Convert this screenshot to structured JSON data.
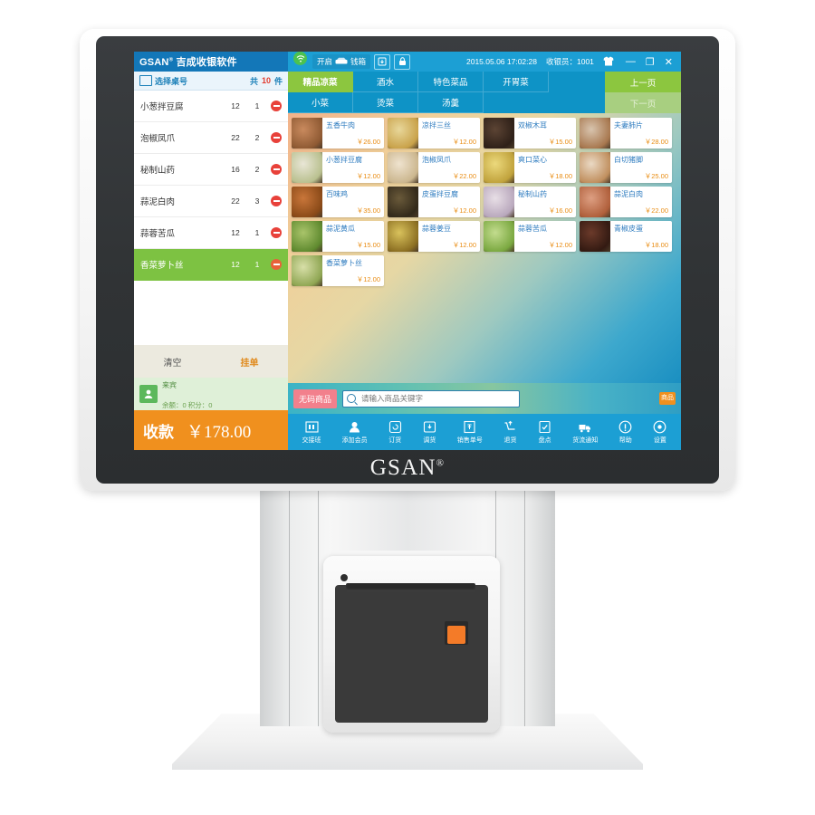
{
  "device": {
    "brand": "GSAN",
    "brand_sup": "®"
  },
  "app": {
    "logo_text": "GSAN",
    "logo_sup": "®",
    "logo_name": "吉成收银软件",
    "drawer_label": "开启",
    "drawer_label2": "钱箱",
    "datetime": "2015.05.06 17:02:28",
    "cashier": "收银员：1001",
    "min_glyph": "—",
    "restore_glyph": "❐",
    "close_glyph": "✕"
  },
  "order": {
    "table_label": "选择桌号",
    "total_prefix": "共",
    "total_count": "10",
    "total_suffix": "件",
    "items": [
      {
        "name": "小葱拌豆腐",
        "price": "12",
        "qty": "1",
        "selected": false
      },
      {
        "name": "泡椒凤爪",
        "price": "22",
        "qty": "2",
        "selected": false
      },
      {
        "name": "秘制山药",
        "price": "16",
        "qty": "2",
        "selected": false
      },
      {
        "name": "蒜泥白肉",
        "price": "22",
        "qty": "3",
        "selected": false
      },
      {
        "name": "蒜蓉苦瓜",
        "price": "12",
        "qty": "1",
        "selected": false
      },
      {
        "name": "香菜萝卜丝",
        "price": "12",
        "qty": "1",
        "selected": true
      }
    ],
    "clear_label": "清空",
    "hold_label": "挂单",
    "member_name": "来宾",
    "member_balance": "余额：0  积分：0",
    "pay_label": "收款",
    "pay_amount": "￥178.00"
  },
  "categories": [
    {
      "label": "精品凉菜",
      "active": true
    },
    {
      "label": "酒水",
      "active": false
    },
    {
      "label": "特色菜品",
      "active": false
    },
    {
      "label": "开胃菜",
      "active": false
    },
    {
      "label": "小菜",
      "active": false
    },
    {
      "label": "烫菜",
      "active": false
    },
    {
      "label": "汤羹",
      "active": false
    }
  ],
  "pager": {
    "prev": "上一页",
    "next": "下一页"
  },
  "products": [
    {
      "name": "五香牛肉",
      "price": "￥26.00",
      "c1": "#c98a5e",
      "c2": "#8f5a33"
    },
    {
      "name": "凉拌三丝",
      "price": "￥12.00",
      "c1": "#e8d79a",
      "c2": "#c9a24a"
    },
    {
      "name": "双椒木耳",
      "price": "￥15.00",
      "c1": "#5c4434",
      "c2": "#2e2018"
    },
    {
      "name": "夫妻肺片",
      "price": "￥28.00",
      "c1": "#d8c4ae",
      "c2": "#a8784f"
    },
    {
      "name": "小葱拌豆腐",
      "price": "￥12.00",
      "c1": "#e9e6d6",
      "c2": "#b9c08f"
    },
    {
      "name": "泡椒凤爪",
      "price": "￥22.00",
      "c1": "#efe3cf",
      "c2": "#cbb68e"
    },
    {
      "name": "爽口菜心",
      "price": "￥18.00",
      "c1": "#ecd97c",
      "c2": "#c0a23c"
    },
    {
      "name": "白切猪脚",
      "price": "￥25.00",
      "c1": "#ead9c4",
      "c2": "#c08f5e"
    },
    {
      "name": "百味鸡",
      "price": "￥35.00",
      "c1": "#c9763a",
      "c2": "#8a4a18"
    },
    {
      "name": "皮蛋拌豆腐",
      "price": "￥12.00",
      "c1": "#6a5a3a",
      "c2": "#32291a"
    },
    {
      "name": "秘制山药",
      "price": "￥16.00",
      "c1": "#e8dfe6",
      "c2": "#b9a8bd"
    },
    {
      "name": "蒜泥白肉",
      "price": "￥22.00",
      "c1": "#dd9f82",
      "c2": "#b05f3b"
    },
    {
      "name": "蒜泥黄瓜",
      "price": "￥15.00",
      "c1": "#a9c46a",
      "c2": "#5f8a2f"
    },
    {
      "name": "蒜蓉姜豆",
      "price": "￥12.00",
      "c1": "#d9c25c",
      "c2": "#8c6f22"
    },
    {
      "name": "蒜蓉苦瓜",
      "price": "￥12.00",
      "c1": "#c3dc8e",
      "c2": "#7aa840"
    },
    {
      "name": "青椒皮蛋",
      "price": "￥18.00",
      "c1": "#6b3a2a",
      "c2": "#331a12"
    },
    {
      "name": "香菜萝卜丝",
      "price": "￥12.00",
      "c1": "#d8dfa8",
      "c2": "#8fa653"
    }
  ],
  "search": {
    "nocode_label": "无码商品",
    "placeholder": "请输入商品关键字",
    "value": "",
    "side_btn": "商品"
  },
  "toolbar": [
    {
      "label": "交接班",
      "icon": "shift-change-icon"
    },
    {
      "label": "添加会员",
      "icon": "add-member-icon"
    },
    {
      "label": "订货",
      "icon": "order-goods-icon"
    },
    {
      "label": "调货",
      "icon": "transfer-goods-icon"
    },
    {
      "label": "销售单号",
      "icon": "sales-order-icon"
    },
    {
      "label": "退货",
      "icon": "return-goods-icon"
    },
    {
      "label": "盘点",
      "icon": "stocktake-icon"
    },
    {
      "label": "货流通知",
      "icon": "logistics-notice-icon"
    },
    {
      "label": "帮助",
      "icon": "help-icon"
    },
    {
      "label": "设置",
      "icon": "settings-icon"
    }
  ]
}
